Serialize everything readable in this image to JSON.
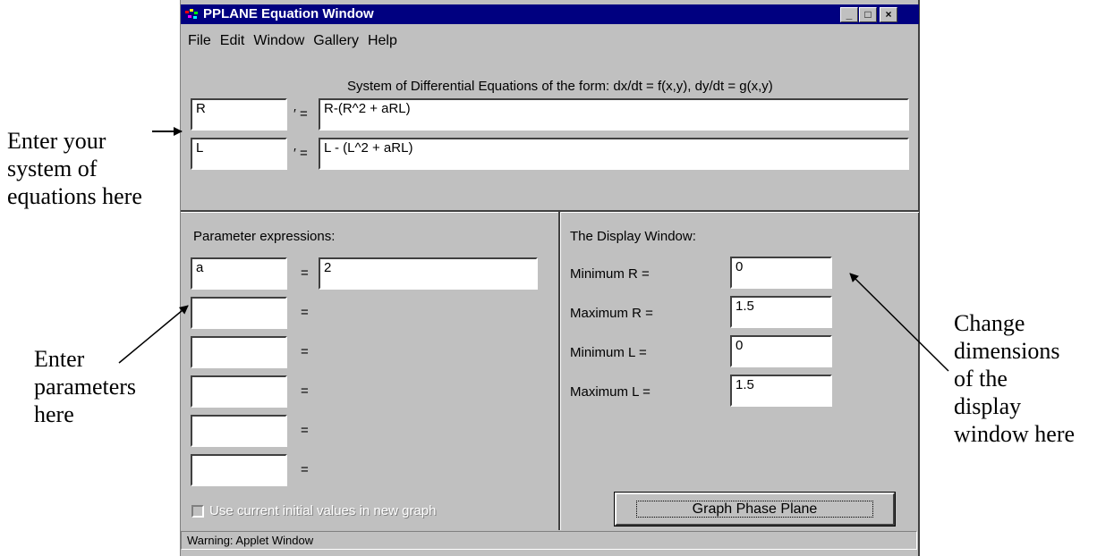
{
  "window": {
    "title": "PPLANE Equation Window",
    "controls": {
      "minimize": "_",
      "maximize": "□",
      "close": "×"
    }
  },
  "menu": [
    "File",
    "Edit",
    "Window",
    "Gallery",
    "Help"
  ],
  "system": {
    "label": "System of Differential Equations of the form: dx/dt = f(x,y), dy/dt = g(x,y)",
    "equations": [
      {
        "variable": "R",
        "prime": "′ =",
        "expression": "R-(R^2 + aRL)"
      },
      {
        "variable": "L",
        "prime": "′ =",
        "expression": "L - (L^2 + aRL)"
      }
    ]
  },
  "parameters": {
    "title": "Parameter expressions:",
    "rows": [
      {
        "name": "a",
        "eq": "=",
        "value": "2"
      },
      {
        "name": "",
        "eq": "=",
        "value": ""
      },
      {
        "name": "",
        "eq": "=",
        "value": ""
      },
      {
        "name": "",
        "eq": "=",
        "value": ""
      },
      {
        "name": "",
        "eq": "=",
        "value": ""
      },
      {
        "name": "",
        "eq": "=",
        "value": ""
      }
    ],
    "checkbox_label": "Use current initial values in new graph",
    "checkbox_checked": false
  },
  "display": {
    "title": "The Display Window:",
    "fields": [
      {
        "label": "Minimum R =",
        "value": "0"
      },
      {
        "label": "Maximum R =",
        "value": "1.5"
      },
      {
        "label": "Minimum L =",
        "value": "0"
      },
      {
        "label": "Maximum L =",
        "value": "1.5"
      }
    ],
    "button": "Graph Phase Plane"
  },
  "status": "Warning: Applet Window",
  "annotations": {
    "equations": "Enter your\nsystem of\nequations here",
    "parameters": "Enter\nparameters\nhere",
    "display": "Change\ndimensions\nof the\ndisplay\nwindow here"
  }
}
